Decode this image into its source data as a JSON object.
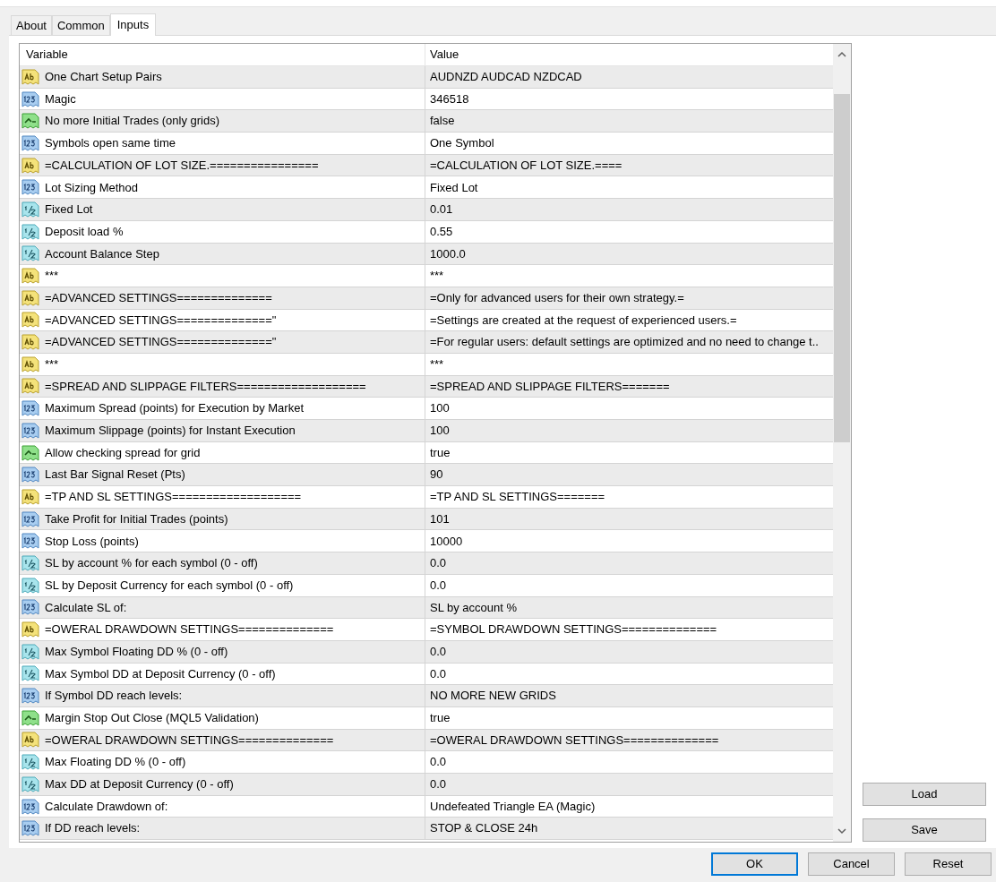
{
  "tabs": [
    {
      "label": "About",
      "selected": false
    },
    {
      "label": "Common",
      "selected": false
    },
    {
      "label": "Inputs",
      "selected": true
    }
  ],
  "table": {
    "columns": [
      "Variable",
      "Value"
    ],
    "rows": [
      {
        "kind": "string",
        "variable": "One Chart Setup Pairs",
        "value": "AUDNZD AUDCAD NZDCAD"
      },
      {
        "kind": "integer",
        "variable": "Magic",
        "value": "346518"
      },
      {
        "kind": "bool",
        "variable": "No more Initial Trades (only grids)",
        "value": "false"
      },
      {
        "kind": "integer",
        "variable": "Symbols open same time",
        "value": "One Symbol"
      },
      {
        "kind": "string",
        "variable": "=CALCULATION OF LOT SIZE.================",
        "value": "=CALCULATION OF LOT SIZE.===="
      },
      {
        "kind": "integer",
        "variable": "Lot Sizing Method",
        "value": "Fixed Lot"
      },
      {
        "kind": "double",
        "variable": "Fixed Lot",
        "value": "0.01"
      },
      {
        "kind": "double",
        "variable": "Deposit load %",
        "value": "0.55"
      },
      {
        "kind": "double",
        "variable": "Account Balance Step",
        "value": "1000.0"
      },
      {
        "kind": "string",
        "variable": "***",
        "value": "***"
      },
      {
        "kind": "string",
        "variable": "=ADVANCED SETTINGS==============",
        "value": "=Only for advanced users for their own strategy.="
      },
      {
        "kind": "string",
        "variable": "=ADVANCED SETTINGS==============\"",
        "value": "=Settings are created at the request of experienced users.="
      },
      {
        "kind": "string",
        "variable": "=ADVANCED SETTINGS==============\"",
        "value": "=For regular users: default settings are optimized and no need to change t.."
      },
      {
        "kind": "string",
        "variable": "***",
        "value": "***"
      },
      {
        "kind": "string",
        "variable": "=SPREAD AND SLIPPAGE FILTERS===================",
        "value": "=SPREAD AND SLIPPAGE FILTERS======="
      },
      {
        "kind": "integer",
        "variable": "Maximum Spread (points) for Execution by Market",
        "value": "100"
      },
      {
        "kind": "integer",
        "variable": "Maximum Slippage (points) for Instant Execution",
        "value": "100"
      },
      {
        "kind": "bool",
        "variable": "Allow checking spread for grid",
        "value": "true"
      },
      {
        "kind": "integer",
        "variable": "Last Bar Signal Reset (Pts)",
        "value": "90"
      },
      {
        "kind": "string",
        "variable": "=TP AND SL SETTINGS===================",
        "value": "=TP AND SL SETTINGS======="
      },
      {
        "kind": "integer",
        "variable": "Take Profit for Initial Trades (points)",
        "value": "101"
      },
      {
        "kind": "integer",
        "variable": "Stop Loss (points)",
        "value": "10000"
      },
      {
        "kind": "double",
        "variable": "SL by account % for each symbol (0 - off)",
        "value": "0.0"
      },
      {
        "kind": "double",
        "variable": "SL by Deposit Currency for each symbol (0 - off)",
        "value": "0.0"
      },
      {
        "kind": "integer",
        "variable": "Calculate SL of:",
        "value": "SL by account %"
      },
      {
        "kind": "string",
        "variable": "=OWERAL DRAWDOWN SETTINGS==============",
        "value": "=SYMBOL DRAWDOWN SETTINGS=============="
      },
      {
        "kind": "double",
        "variable": "Max Symbol Floating DD % (0 - off)",
        "value": "0.0"
      },
      {
        "kind": "double",
        "variable": "Max Symbol DD at Deposit Currency (0 - off)",
        "value": "0.0"
      },
      {
        "kind": "integer",
        "variable": "If Symbol DD reach levels:",
        "value": "NO MORE NEW GRIDS"
      },
      {
        "kind": "bool",
        "variable": "Margin Stop Out Close (MQL5 Validation)",
        "value": "true"
      },
      {
        "kind": "string",
        "variable": "=OWERAL DRAWDOWN SETTINGS==============",
        "value": "=OWERAL DRAWDOWN SETTINGS=============="
      },
      {
        "kind": "double",
        "variable": "Max Floating DD % (0 - off)",
        "value": "0.0"
      },
      {
        "kind": "double",
        "variable": "Max DD at Deposit Currency (0 - off)",
        "value": "0.0"
      },
      {
        "kind": "integer",
        "variable": "Calculate Drawdown of:",
        "value": "Undefeated Triangle EA (Magic)"
      },
      {
        "kind": "integer",
        "variable": "If DD reach levels:",
        "value": "STOP & CLOSE 24h"
      }
    ]
  },
  "side_buttons": [
    "Load",
    "Save"
  ],
  "footer_buttons": [
    {
      "label": "OK",
      "selected": true
    },
    {
      "label": "Cancel",
      "selected": false
    },
    {
      "label": "Reset",
      "selected": false
    }
  ]
}
